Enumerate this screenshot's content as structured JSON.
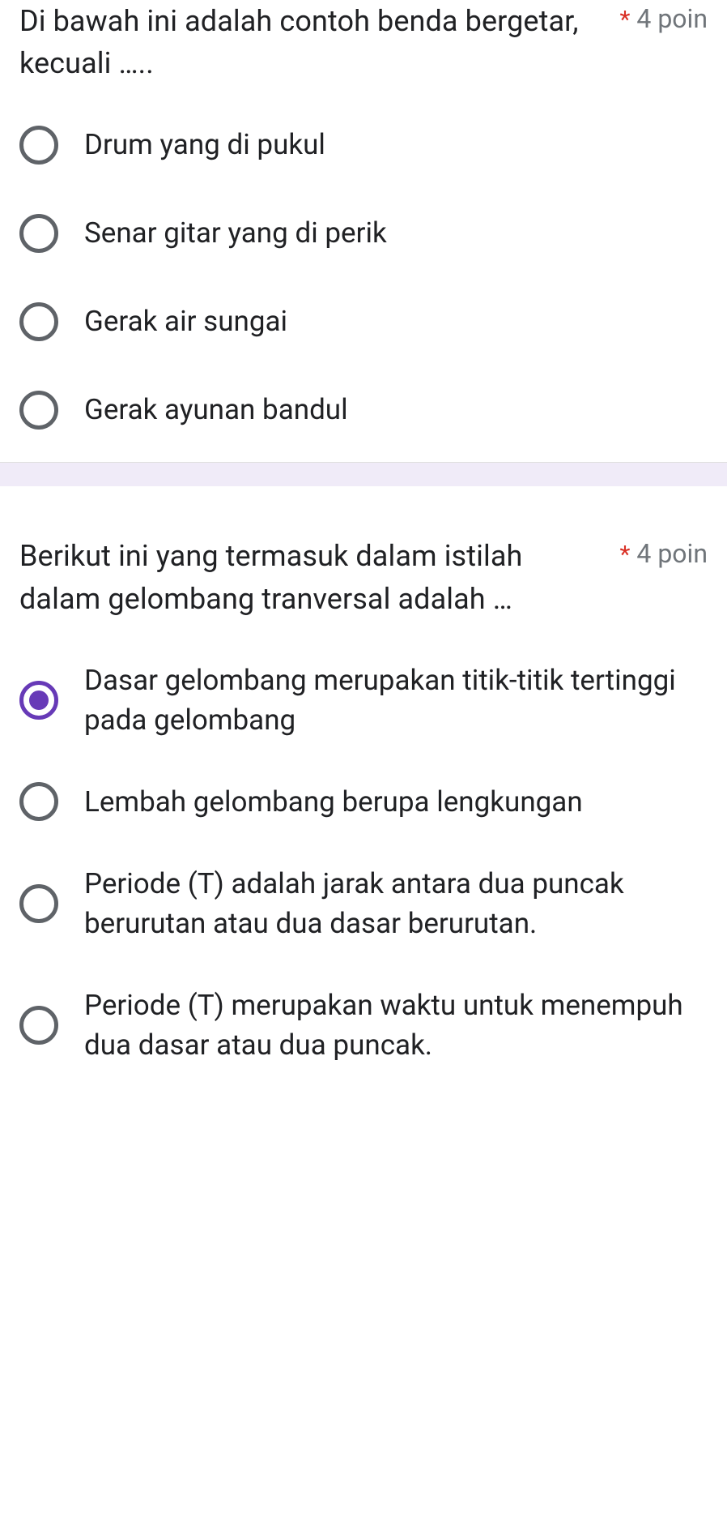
{
  "questions": [
    {
      "text": "Di bawah ini adalah contoh benda bergetar, kecuali …..",
      "required_mark": "*",
      "points": "4 poin",
      "options": [
        {
          "label": "Drum yang di pukul",
          "selected": false
        },
        {
          "label": "Senar gitar yang di perik",
          "selected": false
        },
        {
          "label": "Gerak air sungai",
          "selected": false
        },
        {
          "label": "Gerak ayunan bandul",
          "selected": false
        }
      ]
    },
    {
      "text": "Berikut ini yang termasuk dalam istilah dalam gelombang tranversal adalah …",
      "required_mark": "*",
      "points": "4 poin",
      "options": [
        {
          "label": "Dasar gelombang merupakan titik-titik tertinggi pada gelombang",
          "selected": true
        },
        {
          "label": "Lembah gelombang berupa lengkungan",
          "selected": false
        },
        {
          "label": "Periode (T) adalah jarak antara dua puncak berurutan atau dua dasar berurutan.",
          "selected": false
        },
        {
          "label": "Periode (T) merupakan waktu untuk menempuh dua dasar atau dua puncak.",
          "selected": false
        }
      ]
    }
  ]
}
